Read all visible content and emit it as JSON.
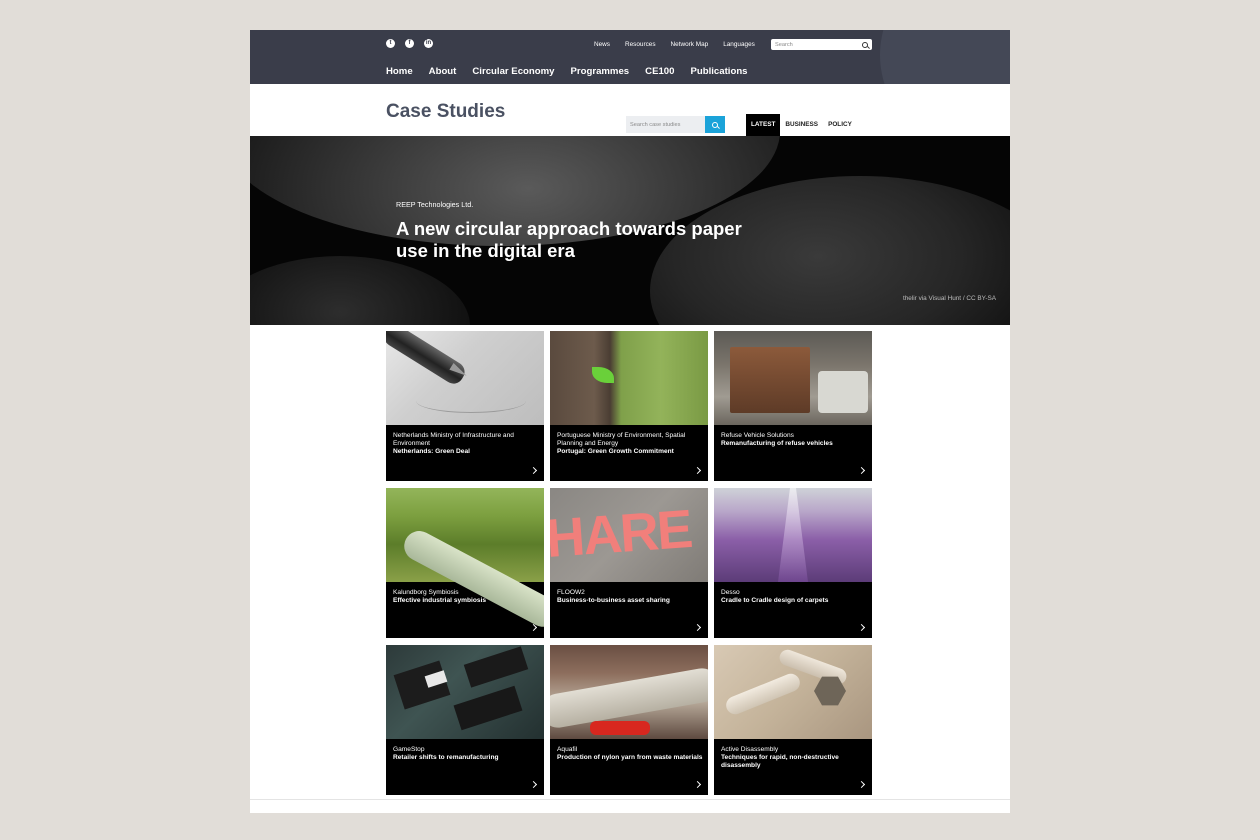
{
  "header": {
    "social": [
      {
        "icon": "twitter-icon",
        "glyph": "t"
      },
      {
        "icon": "facebook-icon",
        "glyph": "f"
      },
      {
        "icon": "linkedin-icon",
        "glyph": "in"
      }
    ],
    "utility_links": [
      "News",
      "Resources",
      "Network Map",
      "Languages"
    ],
    "search_placeholder": "Search",
    "nav": [
      "Home",
      "About",
      "Circular Economy",
      "Programmes",
      "CE100",
      "Publications"
    ]
  },
  "page": {
    "title": "Case Studies",
    "search_placeholder": "Search case studies",
    "tabs": [
      "LATEST",
      "BUSINESS",
      "POLICY"
    ],
    "active_tab": "LATEST"
  },
  "hero": {
    "organisation": "REEP Technologies Ltd.",
    "headline": "A new circular approach towards paper use in the digital era",
    "credit": "thelir via Visual Hunt / CC BY-SA"
  },
  "cards": [
    {
      "organisation": "Netherlands Ministry of Infrastructure and Environment",
      "title": "Netherlands: Green Deal",
      "image": "fountain-pen-signature"
    },
    {
      "organisation": "Portuguese Ministry of Environment, Spatial Planning and Energy",
      "title": "Portugal: Green Growth Commitment",
      "image": "sprout-on-tree"
    },
    {
      "organisation": "Refuse Vehicle Solutions",
      "title": "Remanufacturing of refuse vehicles",
      "image": "refuse-truck"
    },
    {
      "organisation": "Kalundborg Symbiosis",
      "title": "Effective industrial symbiosis",
      "image": "pipeline"
    },
    {
      "organisation": "FLOOW2",
      "title": "Business-to-business asset sharing",
      "image": "share-lettering"
    },
    {
      "organisation": "Desso",
      "title": "Cradle to Cradle design of carpets",
      "image": "carpet-threads"
    },
    {
      "organisation": "GameStop",
      "title": "Retailer shifts to remanufacturing",
      "image": "circuit-board"
    },
    {
      "organisation": "Aquafil",
      "title": "Production of nylon yarn from waste materials",
      "image": "nylon-yarn"
    },
    {
      "organisation": "Active Disassembly",
      "title": "Techniques for rapid, non-destructive disassembly",
      "image": "bolts-and-nut"
    }
  ],
  "colors": {
    "header_bg": "#3a3d4a",
    "title": "#4a5162",
    "search_button": "#1ba3d9",
    "page_bg": "#e1ddd8"
  }
}
